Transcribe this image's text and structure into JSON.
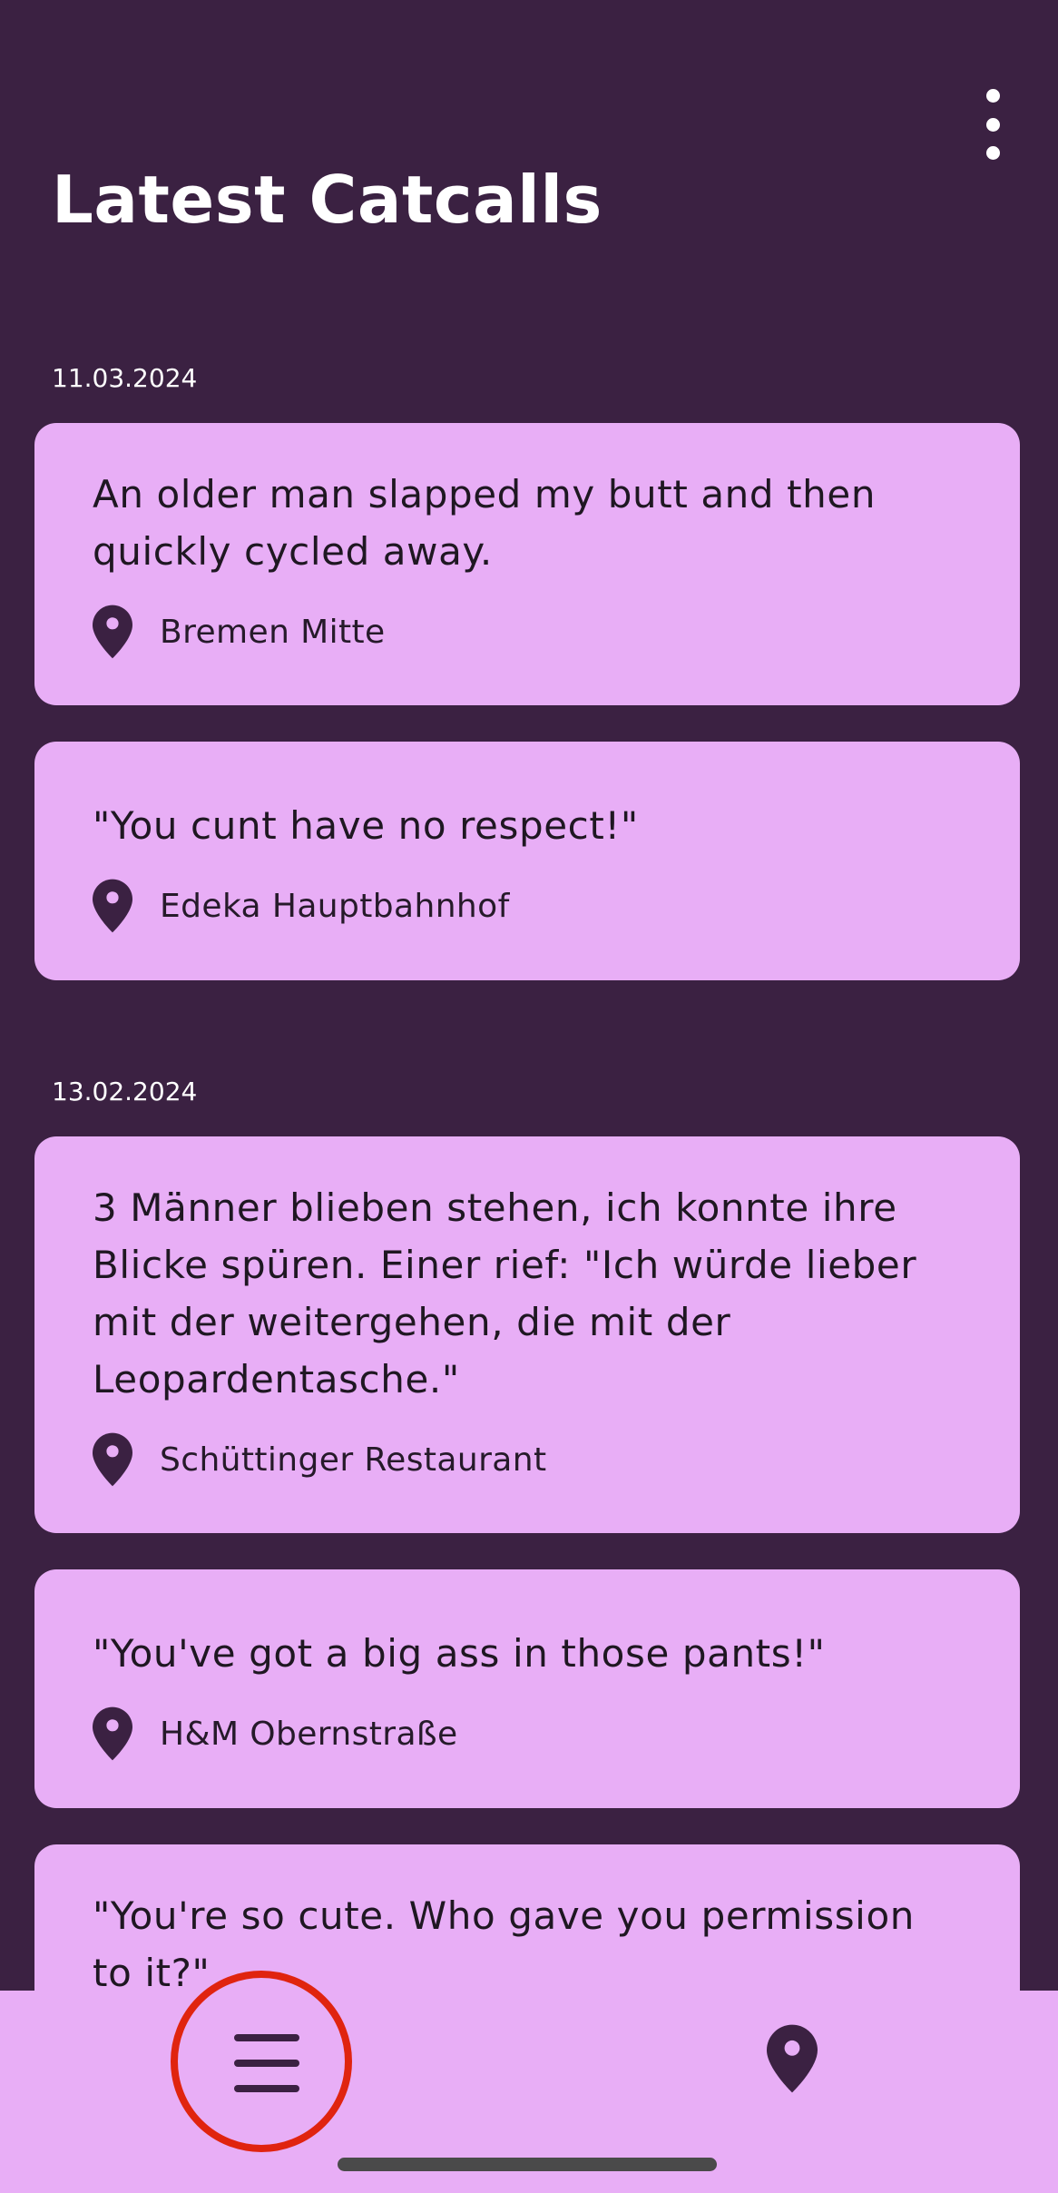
{
  "header": {
    "title": "Latest Catcalls",
    "menu_icon": "more-vert-icon"
  },
  "groups": [
    {
      "date": "11.03.2024",
      "items": [
        {
          "text": "An older man slapped my butt and then quickly cycled away.",
          "location": "Bremen Mitte"
        },
        {
          "text": "\"You cunt have no respect!\"",
          "location": "Edeka Hauptbahnhof"
        }
      ]
    },
    {
      "date": "13.02.2024",
      "items": [
        {
          "text": "3 Männer blieben stehen, ich konnte ihre Blicke spüren. Einer rief: \"Ich würde lieber mit der weitergehen, die mit der Leopardentasche.\"",
          "location": "Schüttinger Restaurant"
        },
        {
          "text": "\"You've got a big ass in those pants!\"",
          "location": "H&M Obernstraße"
        },
        {
          "text": "\"You're so cute. Who gave you permission to it?\""
        }
      ]
    }
  ],
  "bottom_nav": {
    "items": [
      {
        "icon": "hamburger-menu-icon",
        "highlighted": true
      },
      {
        "icon": "map-pin-icon",
        "highlighted": false
      }
    ]
  },
  "colors": {
    "background": "#3b2142",
    "card": "#e8aef6",
    "text_dark": "#1f1722",
    "highlight_ring": "#e0240f"
  }
}
